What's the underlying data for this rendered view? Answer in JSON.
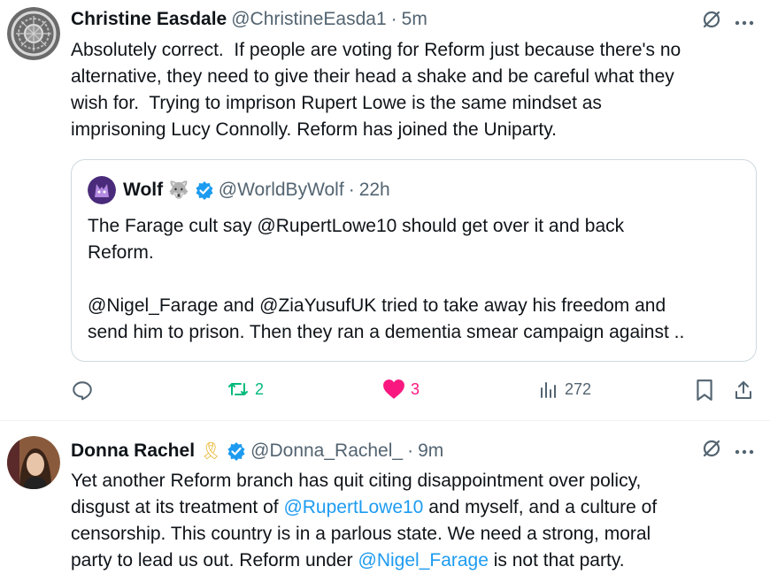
{
  "tweet1": {
    "name": "Christine Easdale",
    "handle": "@ChristineEasda1",
    "separator": "·",
    "time": "5m",
    "text": "Absolutely correct.  If people are voting for Reform just because there's no\nalternative, they need to give their head a shake and be careful what they\nwish for.  Trying to imprison Rupert Lowe is the same mindset as\nimprisoning Lucy Connolly. Reform has joined the Uniparty.",
    "quote": {
      "name": "Wolf",
      "emoji": "🐺",
      "handle": "@WorldByWolf",
      "separator": "·",
      "time": "22h",
      "text": "The Farage cult say @RupertLowe10 should get over it and back\nReform.\n\n@Nigel_Farage and @ZiaYusufUK tried to take away his freedom and\nsend him to prison. Then they ran a dementia smear campaign against .."
    },
    "actions": {
      "retweets": "2",
      "likes": "3",
      "views": "272"
    }
  },
  "tweet2": {
    "name": "Donna Rachel",
    "emoji": "🎗",
    "handle": "@Donna_Rachel_",
    "separator": "·",
    "time": "9m",
    "text_part1": "Yet another Reform branch has quit citing disappointment over policy,\ndisgust at its treatment of ",
    "mention1": "@RupertLowe10",
    "text_part2": " and myself, and a culture of\ncensorship. This country is in a parlous state. We need a strong, moral\nparty to lead us out. Reform under ",
    "mention2": "@Nigel_Farage",
    "text_part3": " is not that party."
  },
  "colors": {
    "accent": "#1d9bf0",
    "retweet": "#00ba7c",
    "like": "#f91880",
    "muted": "#536471"
  }
}
